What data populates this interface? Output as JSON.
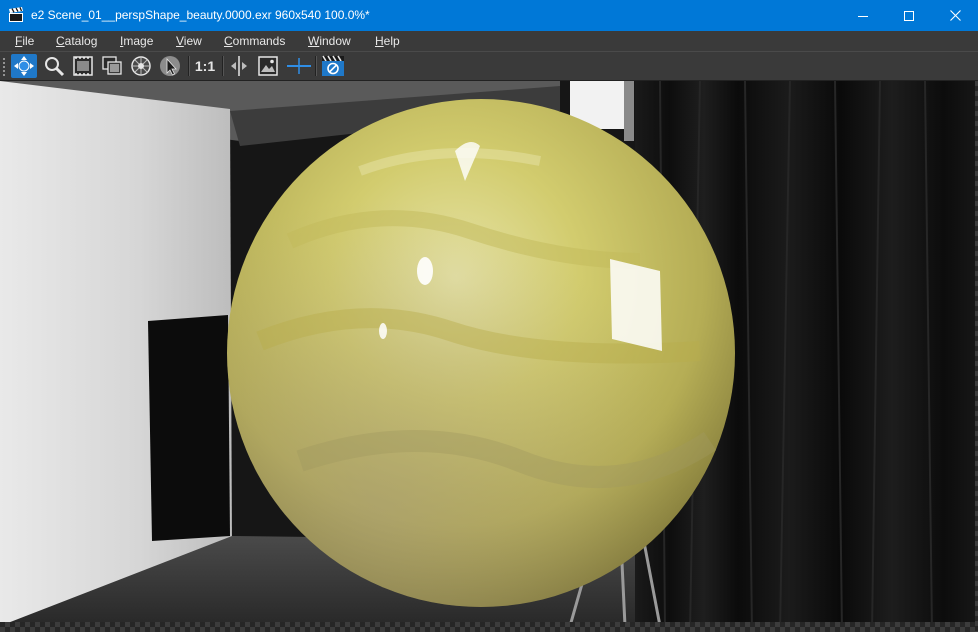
{
  "window": {
    "title": "e2 Scene_01__perspShape_beauty.0000.exr 960x540 100.0%*",
    "app_icon": "clapper-icon",
    "controls": [
      "minimize-icon",
      "maximize-icon",
      "close-icon"
    ]
  },
  "menu": [
    {
      "label": "File",
      "accel": "F",
      "rest": "ile"
    },
    {
      "label": "Catalog",
      "accel": "C",
      "rest": "atalog"
    },
    {
      "label": "Image",
      "accel": "I",
      "rest": "mage"
    },
    {
      "label": "View",
      "accel": "V",
      "rest": "iew"
    },
    {
      "label": "Commands",
      "accel": "C",
      "rest": "ommands"
    },
    {
      "label": "Window",
      "accel": "W",
      "rest": "indow"
    },
    {
      "label": "Help",
      "accel": "H",
      "rest": "elp"
    }
  ],
  "toolbar": {
    "buttons": [
      {
        "icon": "pan-arrows-icon",
        "active": true
      },
      {
        "icon": "zoom-magnifier-icon"
      },
      {
        "icon": "film-frame-icon"
      },
      {
        "icon": "image-stack-icon"
      },
      {
        "icon": "color-wheel-icon"
      },
      {
        "icon": "pointer-icon"
      },
      {
        "icon": "one-to-one-icon",
        "label": "1:1"
      },
      {
        "icon": "split-compare-icon"
      },
      {
        "icon": "picture-icon"
      },
      {
        "icon": "crosshair-line-icon"
      },
      {
        "icon": "clapper-no-icon"
      }
    ]
  },
  "colors": {
    "titlebar": "#0078d7",
    "menubar": "#3a3a3a",
    "active_tool": "#1f78c8",
    "sphere_yellow": "#c9c35e"
  },
  "viewer": {
    "resolution_shown": "960x540",
    "zoom": "100.0%",
    "content": "render-image"
  }
}
